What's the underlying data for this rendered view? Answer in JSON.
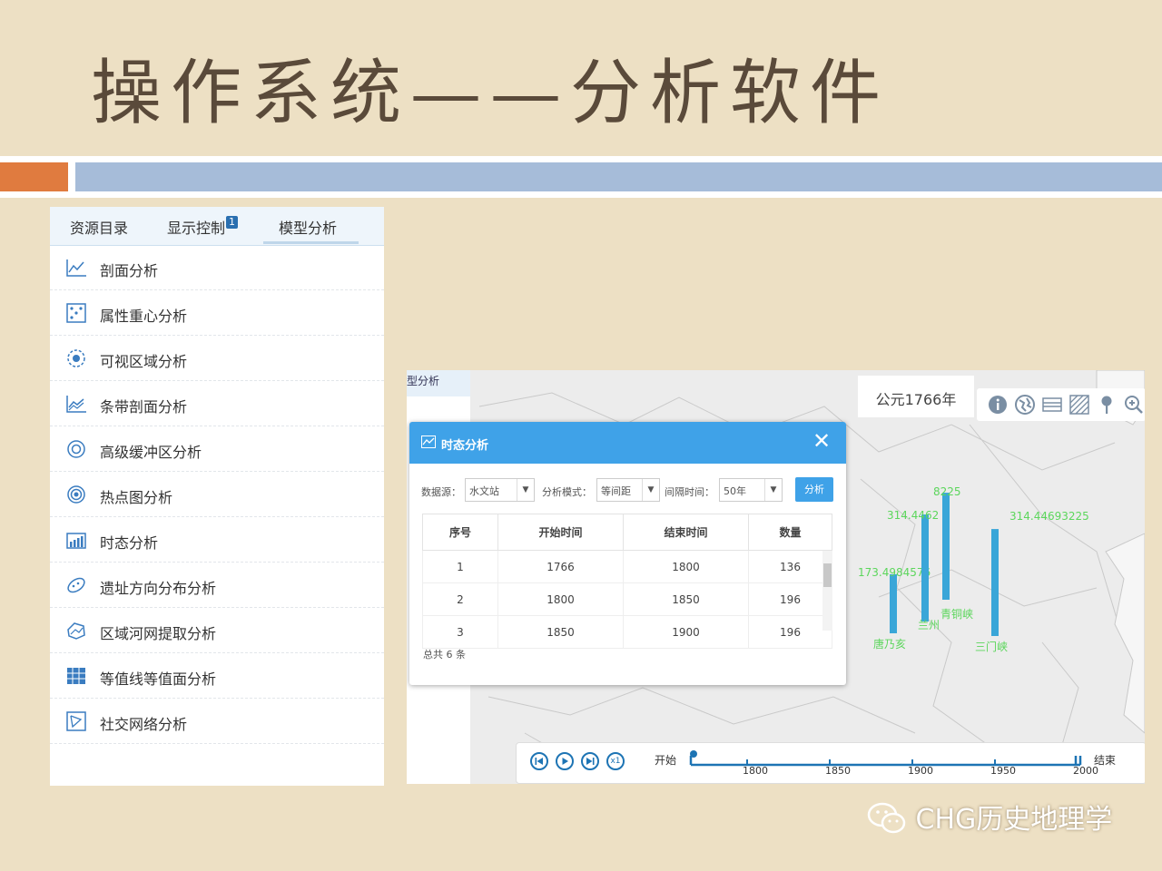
{
  "slide": {
    "title": "操作系统——分析软件",
    "watermark": "CHG历史地理学"
  },
  "colors": {
    "accent_orange": "#e07b3f",
    "accent_blue": "#a6bcd9",
    "dialog_header": "#3fa2e8",
    "bar_fill": "#3aa6d8",
    "bar_label": "#5cd65c"
  },
  "panel": {
    "tabs": [
      {
        "label": "资源目录"
      },
      {
        "label": "显示控制",
        "badge": "1"
      },
      {
        "label": "模型分析",
        "active": true
      }
    ],
    "items": [
      {
        "label": "剖面分析",
        "icon": "line-chart-icon"
      },
      {
        "label": "属性重心分析",
        "icon": "dice-icon"
      },
      {
        "label": "可视区域分析",
        "icon": "viewshed-icon"
      },
      {
        "label": "条带剖面分析",
        "icon": "area-chart-icon"
      },
      {
        "label": "高级缓冲区分析",
        "icon": "buffer-ring-icon"
      },
      {
        "label": "热点图分析",
        "icon": "hotspot-icon"
      },
      {
        "label": "时态分析",
        "icon": "bar-chart-icon"
      },
      {
        "label": "遗址方向分布分析",
        "icon": "direction-ellipse-icon"
      },
      {
        "label": "区域河网提取分析",
        "icon": "river-network-icon"
      },
      {
        "label": "等值线等值面分析",
        "icon": "contour-grid-icon"
      },
      {
        "label": "社交网络分析",
        "icon": "network-icon"
      }
    ]
  },
  "map": {
    "side_tab": "型分析",
    "year": "公元1766年",
    "tools": [
      "info-icon",
      "globe-icon",
      "layers-icon",
      "hatch-icon",
      "pin-icon",
      "zoom-in-icon"
    ],
    "bars": [
      {
        "station": "唐乃亥",
        "value_label": "173.4984576",
        "value": 173.4984576
      },
      {
        "station": "兰州",
        "value_label": "314.4462",
        "value": 314.4462
      },
      {
        "station": "青铜峡",
        "value_label": "8225",
        "value": 314.44
      },
      {
        "station": "三门峡",
        "value_label": "314.44693225",
        "value": 314.44693225
      }
    ],
    "dialog": {
      "title": "时态分析",
      "close": "✕",
      "controls": [
        {
          "label": "数据源：",
          "value": "水文站"
        },
        {
          "label": "分析模式：",
          "value": "等间距"
        },
        {
          "label": "间隔时间：",
          "value": "50年"
        }
      ],
      "submit": "分析",
      "columns": [
        "序号",
        "开始时间",
        "结束时间",
        "数量"
      ],
      "rows": [
        [
          "1",
          "1766",
          "1800",
          "136"
        ],
        [
          "2",
          "1800",
          "1850",
          "196"
        ],
        [
          "3",
          "1850",
          "1900",
          "196"
        ]
      ],
      "total": "总共 6 条"
    },
    "timeline": {
      "start": "开始",
      "end": "结束",
      "speed": "x1",
      "ticks": [
        "1800",
        "1850",
        "1900",
        "1950",
        "2000"
      ]
    }
  }
}
